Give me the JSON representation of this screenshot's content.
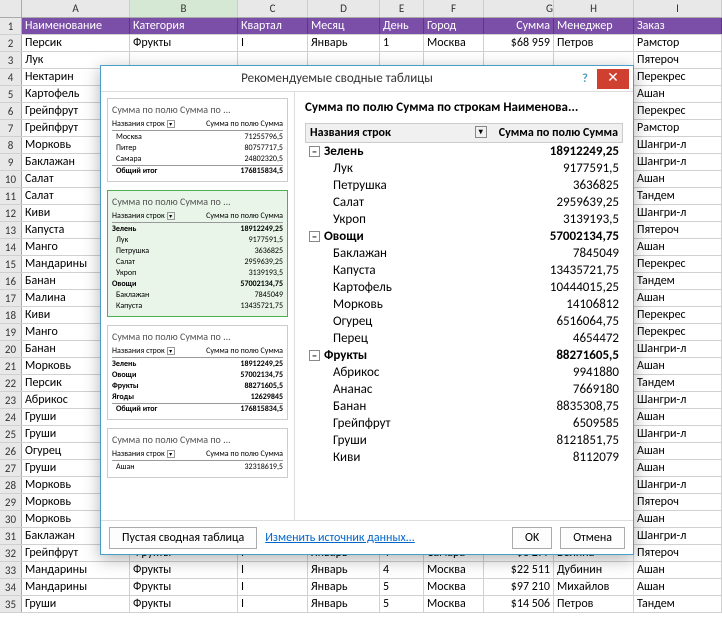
{
  "columns": [
    "A",
    "B",
    "C",
    "D",
    "E",
    "F",
    "G",
    "H",
    "I"
  ],
  "selected_col": "B",
  "header_row": [
    "Наименование",
    "Категория",
    "Квартал",
    "Месяц",
    "День",
    "Город",
    "Сумма",
    "Менеджер",
    "Заказ"
  ],
  "rows": [
    {
      "n": 2,
      "c": [
        "Персик",
        "Фрукты",
        "I",
        "Январь",
        "1",
        "Москва",
        "$68 959",
        "Петров",
        "Рамстор"
      ]
    },
    {
      "n": 3,
      "c": [
        "Лук",
        "",
        "",
        "",
        "",
        "",
        "",
        "",
        "Пятероч"
      ]
    },
    {
      "n": 4,
      "c": [
        "Нектарин",
        "",
        "",
        "",
        "",
        "",
        "",
        "",
        "Перекрес"
      ]
    },
    {
      "n": 5,
      "c": [
        "Картофель",
        "",
        "",
        "",
        "",
        "",
        "",
        "",
        "Ашан"
      ]
    },
    {
      "n": 6,
      "c": [
        "Грейпфрут",
        "",
        "",
        "",
        "",
        "",
        "",
        "",
        "Перекрес"
      ]
    },
    {
      "n": 7,
      "c": [
        "Грейпфрут",
        "",
        "",
        "",
        "",
        "",
        "",
        "",
        "Рамстор"
      ]
    },
    {
      "n": 8,
      "c": [
        "Морковь",
        "",
        "",
        "",
        "",
        "",
        "",
        "",
        "Шангри-л"
      ]
    },
    {
      "n": 9,
      "c": [
        "Баклажан",
        "",
        "",
        "",
        "",
        "",
        "",
        "",
        "Шангри-л"
      ]
    },
    {
      "n": 10,
      "c": [
        "Салат",
        "",
        "",
        "",
        "",
        "",
        "",
        "",
        "Ашан"
      ]
    },
    {
      "n": 11,
      "c": [
        "Салат",
        "",
        "",
        "",
        "",
        "",
        "",
        "",
        "Тандем"
      ]
    },
    {
      "n": 12,
      "c": [
        "Киви",
        "",
        "",
        "",
        "",
        "",
        "",
        "",
        "Шангри-л"
      ]
    },
    {
      "n": 13,
      "c": [
        "Капуста",
        "",
        "",
        "",
        "",
        "",
        "",
        "",
        "Пятероч"
      ]
    },
    {
      "n": 14,
      "c": [
        "Манго",
        "",
        "",
        "",
        "",
        "",
        "",
        "в",
        "Ашан"
      ]
    },
    {
      "n": 15,
      "c": [
        "Мандарины",
        "",
        "",
        "",
        "",
        "",
        "",
        "",
        "Перекрес"
      ]
    },
    {
      "n": 16,
      "c": [
        "Банан",
        "",
        "",
        "",
        "",
        "",
        "",
        "",
        "Тандем"
      ]
    },
    {
      "n": 17,
      "c": [
        "Малина",
        "",
        "",
        "",
        "",
        "",
        "",
        "",
        "Ашан"
      ]
    },
    {
      "n": 18,
      "c": [
        "Киви",
        "",
        "",
        "",
        "",
        "",
        "",
        "в",
        "Перекрес"
      ]
    },
    {
      "n": 19,
      "c": [
        "Манго",
        "",
        "",
        "",
        "",
        "",
        "",
        "",
        "Перекрес"
      ]
    },
    {
      "n": 20,
      "c": [
        "Банан",
        "",
        "",
        "",
        "",
        "",
        "",
        "",
        "Шангри-л"
      ]
    },
    {
      "n": 21,
      "c": [
        "Морковь",
        "",
        "",
        "",
        "",
        "",
        "",
        "",
        "Ашан"
      ]
    },
    {
      "n": 22,
      "c": [
        "Персик",
        "",
        "",
        "",
        "",
        "",
        "",
        "",
        "Тандем"
      ]
    },
    {
      "n": 23,
      "c": [
        "Абрикос",
        "",
        "",
        "",
        "",
        "",
        "",
        "",
        "Шангри-л"
      ]
    },
    {
      "n": 24,
      "c": [
        "Груши",
        "",
        "",
        "",
        "",
        "",
        "",
        "",
        "Ашан"
      ]
    },
    {
      "n": 25,
      "c": [
        "Груши",
        "",
        "",
        "",
        "",
        "",
        "",
        "",
        "Шангри-л"
      ]
    },
    {
      "n": 26,
      "c": [
        "Огурец",
        "",
        "",
        "",
        "",
        "",
        "",
        "",
        "Ашан"
      ]
    },
    {
      "n": 27,
      "c": [
        "Груши",
        "",
        "",
        "",
        "",
        "",
        "",
        "",
        "Ашан"
      ]
    },
    {
      "n": 28,
      "c": [
        "Морковь",
        "",
        "",
        "",
        "",
        "",
        "",
        "",
        "Шангри-л"
      ]
    },
    {
      "n": 29,
      "c": [
        "Морковь",
        "",
        "",
        "",
        "",
        "",
        "",
        "",
        "Пятероч"
      ]
    },
    {
      "n": 30,
      "c": [
        "Морковь",
        "",
        "",
        "",
        "",
        "",
        "",
        "",
        "Ашан"
      ]
    },
    {
      "n": 31,
      "c": [
        "Баклажан",
        "",
        "",
        "",
        "",
        "",
        "",
        "",
        "Шангри-л"
      ]
    },
    {
      "n": 32,
      "c": [
        "Грейпфрут",
        "Фрукты",
        "I",
        "Январь",
        "4",
        "Самара",
        "$6 277",
        "Волина",
        "Пятероч"
      ]
    },
    {
      "n": 33,
      "c": [
        "Мандарины",
        "Фрукты",
        "I",
        "Январь",
        "4",
        "Москва",
        "$22 511",
        "Дубинин",
        "Ашан"
      ]
    },
    {
      "n": 34,
      "c": [
        "Мандарины",
        "Фрукты",
        "I",
        "Январь",
        "5",
        "Москва",
        "$97 210",
        "Михайлов",
        "Ашан"
      ]
    },
    {
      "n": 35,
      "c": [
        "Груши",
        "Фрукты",
        "I",
        "Январь",
        "5",
        "Москва",
        "$14 506",
        "Петров",
        "Тандем"
      ]
    }
  ],
  "dialog": {
    "title": "Рекомендуемые сводные таблицы",
    "right_title": "Сумма по полю Сумма по строкам Наименова...",
    "pvt_header": {
      "col1": "Названия строк",
      "col2": "Сумма по полю Сумма"
    },
    "thumbs": [
      {
        "title": "Сумма по полю Сумма по ...",
        "hdr": [
          "Названия строк",
          "Сумма по полю Сумма"
        ],
        "rows": [
          {
            "l": "Москва",
            "v": "71255796,5"
          },
          {
            "l": "Питер",
            "v": "80757717,5"
          },
          {
            "l": "Самара",
            "v": "24802320,5"
          }
        ],
        "total": {
          "l": "Общий итог",
          "v": "176815834,5"
        },
        "sel": false
      },
      {
        "title": "Сумма по полю Сумма по ...",
        "hdr": [
          "Названия строк",
          "Сумма по полю Сумма"
        ],
        "rows": [
          {
            "l": "Зелень",
            "v": "18912249,25",
            "b": true
          },
          {
            "l": "Лук",
            "v": "9177591,5"
          },
          {
            "l": "Петрушка",
            "v": "3636825"
          },
          {
            "l": "Салат",
            "v": "2959639,25"
          },
          {
            "l": "Укроп",
            "v": "3139193,5"
          },
          {
            "l": "Овощи",
            "v": "57002134,75",
            "b": true
          },
          {
            "l": "Баклажан",
            "v": "7845049"
          },
          {
            "l": "Капуста",
            "v": "13435721,75"
          }
        ],
        "sel": true
      },
      {
        "title": "Сумма по полю Сумма по ...",
        "hdr": [
          "Названия строк",
          "Сумма по полю Сумма"
        ],
        "rows": [
          {
            "l": "Зелень",
            "v": "18912249,25",
            "b": true
          },
          {
            "l": "Овощи",
            "v": "57002134,75",
            "b": true
          },
          {
            "l": "Фрукты",
            "v": "88271605,5",
            "b": true
          },
          {
            "l": "Ягоды",
            "v": "12629845",
            "b": true
          }
        ],
        "total": {
          "l": "Общий итог",
          "v": "176815834,5"
        },
        "sel": false
      },
      {
        "title": "Сумма по полю Сумма по ...",
        "hdr": [
          "Названия строк",
          "Сумма по полю Сумма"
        ],
        "rows": [
          {
            "l": "Ашан",
            "v": "32318619,5"
          }
        ],
        "sel": false
      }
    ],
    "pivot": [
      {
        "t": "grp",
        "l": "Зелень",
        "v": "18912249,25"
      },
      {
        "t": "item",
        "l": "Лук",
        "v": "9177591,5"
      },
      {
        "t": "item",
        "l": "Петрушка",
        "v": "3636825"
      },
      {
        "t": "item",
        "l": "Салат",
        "v": "2959639,25"
      },
      {
        "t": "item",
        "l": "Укроп",
        "v": "3139193,5"
      },
      {
        "t": "grp",
        "l": "Овощи",
        "v": "57002134,75"
      },
      {
        "t": "item",
        "l": "Баклажан",
        "v": "7845049"
      },
      {
        "t": "item",
        "l": "Капуста",
        "v": "13435721,75"
      },
      {
        "t": "item",
        "l": "Картофель",
        "v": "10444015,25"
      },
      {
        "t": "item",
        "l": "Морковь",
        "v": "14106812"
      },
      {
        "t": "item",
        "l": "Огурец",
        "v": "6516064,75"
      },
      {
        "t": "item",
        "l": "Перец",
        "v": "4654472"
      },
      {
        "t": "grp",
        "l": "Фрукты",
        "v": "88271605,5"
      },
      {
        "t": "item",
        "l": "Абрикос",
        "v": "9941880"
      },
      {
        "t": "item",
        "l": "Ананас",
        "v": "7669180"
      },
      {
        "t": "item",
        "l": "Банан",
        "v": "8835308,75"
      },
      {
        "t": "item",
        "l": "Грейпфрут",
        "v": "6509585"
      },
      {
        "t": "item",
        "l": "Груши",
        "v": "8121851,75"
      },
      {
        "t": "item",
        "l": "Киви",
        "v": "8112079"
      }
    ],
    "footer": {
      "blank": "Пустая сводная таблица",
      "change_src": "Изменить источник данных...",
      "ok": "OK",
      "cancel": "Отмена"
    }
  }
}
